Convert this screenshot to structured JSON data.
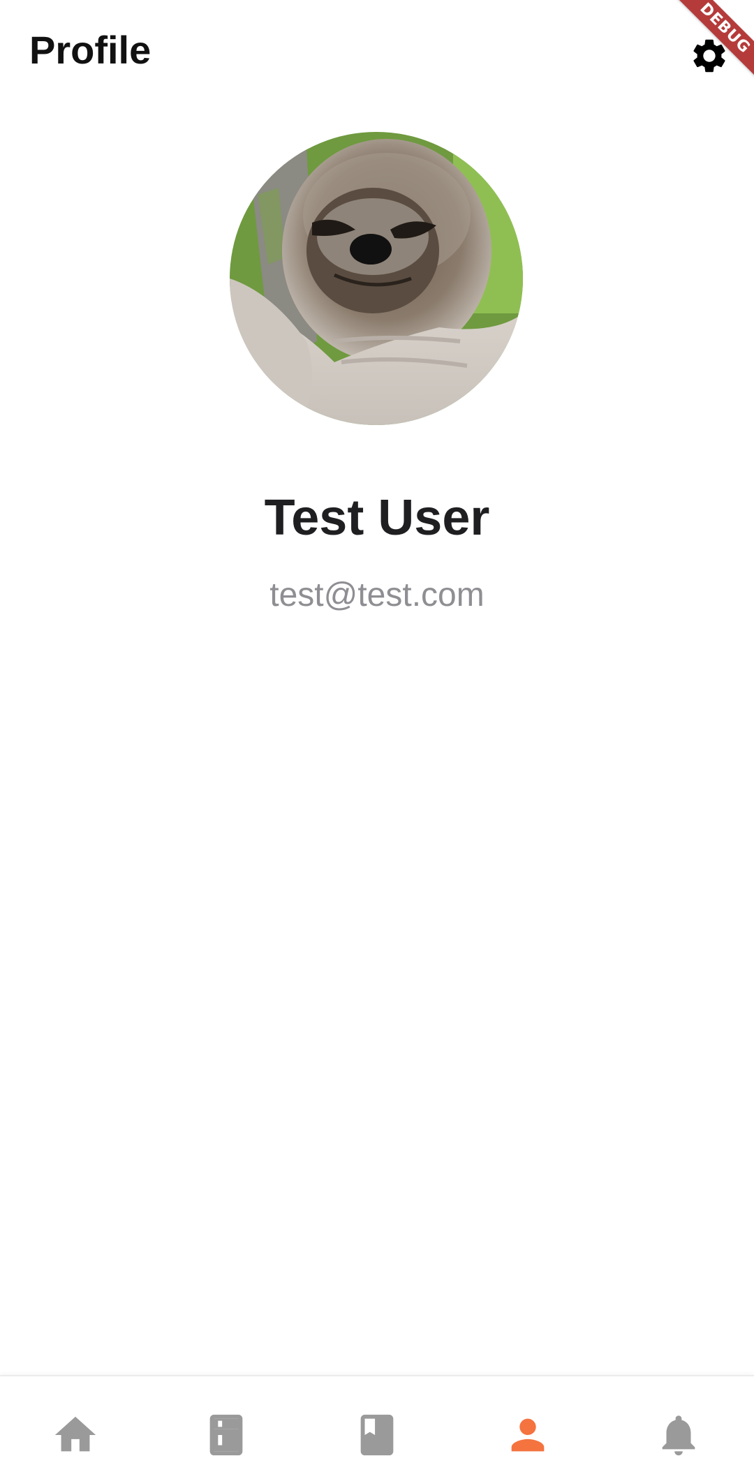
{
  "app_bar": {
    "title": "Profile",
    "settings_icon": "gear-icon"
  },
  "debug_banner": {
    "label": "DEBUG"
  },
  "profile": {
    "avatar_subject": "sloth-photo",
    "name": "Test User",
    "email": "test@test.com"
  },
  "bottom_nav": {
    "items": [
      {
        "id": "home",
        "icon": "home-icon",
        "active": false
      },
      {
        "id": "fridge",
        "icon": "fridge-icon",
        "active": false
      },
      {
        "id": "recipes",
        "icon": "book-icon",
        "active": false
      },
      {
        "id": "profile",
        "icon": "person-icon",
        "active": true
      },
      {
        "id": "notifications",
        "icon": "bell-icon",
        "active": false
      }
    ],
    "active_color": "#f4733f",
    "inactive_color": "#9a9a9a"
  },
  "colors": {
    "background": "#ffffff",
    "title_text": "#111111",
    "name_text": "#1f1f22",
    "email_text": "#8e8e93",
    "debug_ribbon": "#b53b3b"
  }
}
